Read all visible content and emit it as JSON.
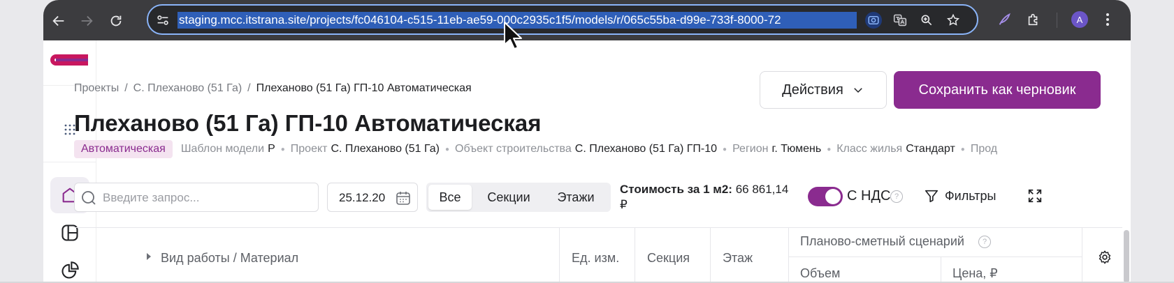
{
  "browser": {
    "url": "staging.mcc.itstrana.site/projects/fc046104-c515-11eb-ae59-000c2935c1f5/models/r/065c55ba-d99e-733f-8000-72",
    "avatar_letter": "A",
    "icons": [
      "back-icon",
      "forward-icon",
      "reload-icon",
      "site-settings-icon",
      "google-lens-icon",
      "translate-icon",
      "zoom-icon",
      "bookmark-star-icon",
      "extension-feather-icon",
      "extensions-puzzle-icon",
      "kebab-menu-icon"
    ]
  },
  "sidebar": {
    "items": [
      {
        "name": "home",
        "icon": "home-icon",
        "active": true
      },
      {
        "name": "layout",
        "icon": "layout-icon",
        "active": false
      },
      {
        "name": "analytics",
        "icon": "pie-chart-icon",
        "active": false
      }
    ],
    "accent": "#8a2b8f"
  },
  "header": {
    "breadcrumb": [
      "Проекты",
      "С. Плеханово (51 Га)",
      "Плеханово (51 Га) ГП-10 Автоматическая"
    ],
    "breadcrumb_sep": "/",
    "actions_label": "Действия",
    "save_label": "Сохранить как черновик",
    "title": "Плеханово (51 Га) ГП-10 Автоматическая",
    "badge": "Автоматическая",
    "meta": [
      {
        "key": "Шаблон модели",
        "value": "Р"
      },
      {
        "key": "Проект",
        "value": "С. Плеханово (51 Га)"
      },
      {
        "key": "Объект строительства",
        "value": "С. Плеханово (51 Га) ГП-10"
      },
      {
        "key": "Регион",
        "value": "г. Тюмень"
      },
      {
        "key": "Класс жилья",
        "value": "Стандарт"
      },
      {
        "key": "Прод",
        "value": ""
      }
    ]
  },
  "toolbar": {
    "search_placeholder": "Введите запрос...",
    "date": "25.12.20",
    "segments": [
      "Все",
      "Секции",
      "Этажи"
    ],
    "active_segment": "Все",
    "cost_label": "Стоимость за 1 м2:",
    "cost_value": "66 861,14",
    "cost_currency": "₽",
    "vat_label": "С НДС",
    "vat_enabled": true,
    "help_glyph": "?",
    "filters_label": "Фильтры"
  },
  "table": {
    "columns": [
      "Вид работы / Материал",
      "Ед. изм.",
      "Секция",
      "Этаж"
    ],
    "group_header": "Планово-сметный сценарий",
    "sub_columns": [
      "Объем",
      "Цена, ₽"
    ]
  }
}
